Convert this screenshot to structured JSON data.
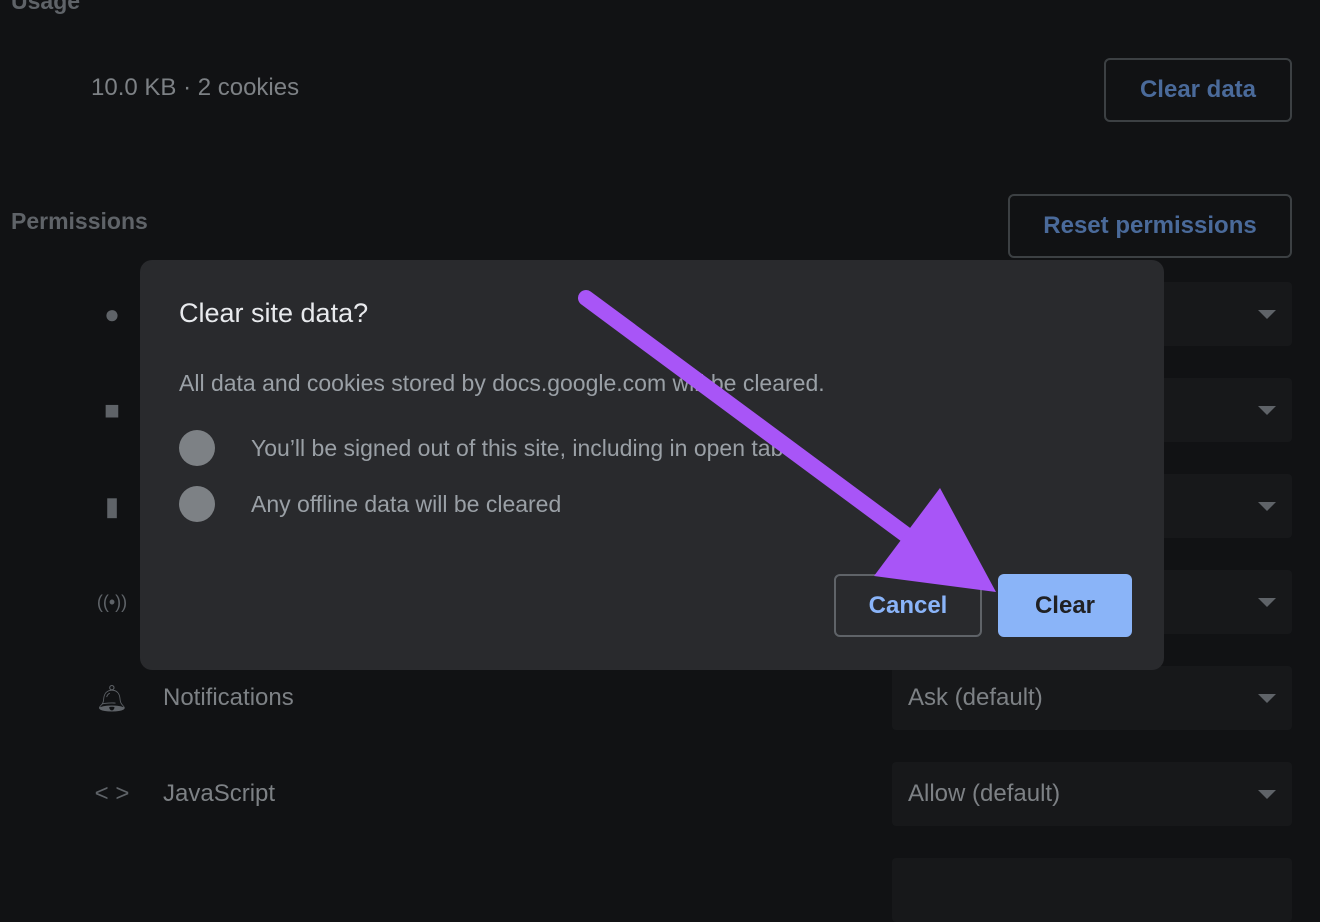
{
  "usage": {
    "heading": "Usage",
    "summary": "10.0 KB · 2 cookies",
    "clear_data_label": "Clear data"
  },
  "permissions": {
    "heading": "Permissions",
    "reset_label": "Reset permissions",
    "rows": [
      {
        "icon": "location-icon",
        "label": "",
        "value": ""
      },
      {
        "icon": "camera-icon",
        "label": "",
        "value": ""
      },
      {
        "icon": "microphone-icon",
        "label": "",
        "value": ""
      },
      {
        "icon": "sensors-icon",
        "label": "",
        "value": ""
      },
      {
        "icon": "bell-icon",
        "label": "Notifications",
        "value": "Ask (default)"
      },
      {
        "icon": "code-icon",
        "label": "JavaScript",
        "value": "Allow (default)"
      }
    ]
  },
  "dialog": {
    "title": "Clear site data?",
    "body": "All data and cookies stored by docs.google.com will be cleared.",
    "items": [
      {
        "icon": "account-icon",
        "text": "You’ll be signed out of this site, including in open tabs"
      },
      {
        "icon": "offline-check-icon",
        "text": "Any offline data will be cleared"
      }
    ],
    "cancel_label": "Cancel",
    "clear_label": "Clear"
  },
  "annotation": {
    "arrow_color": "#a855f7"
  },
  "colors": {
    "accent": "#8ab4f8",
    "dialog_bg": "#292a2d",
    "page_bg": "#111214"
  }
}
